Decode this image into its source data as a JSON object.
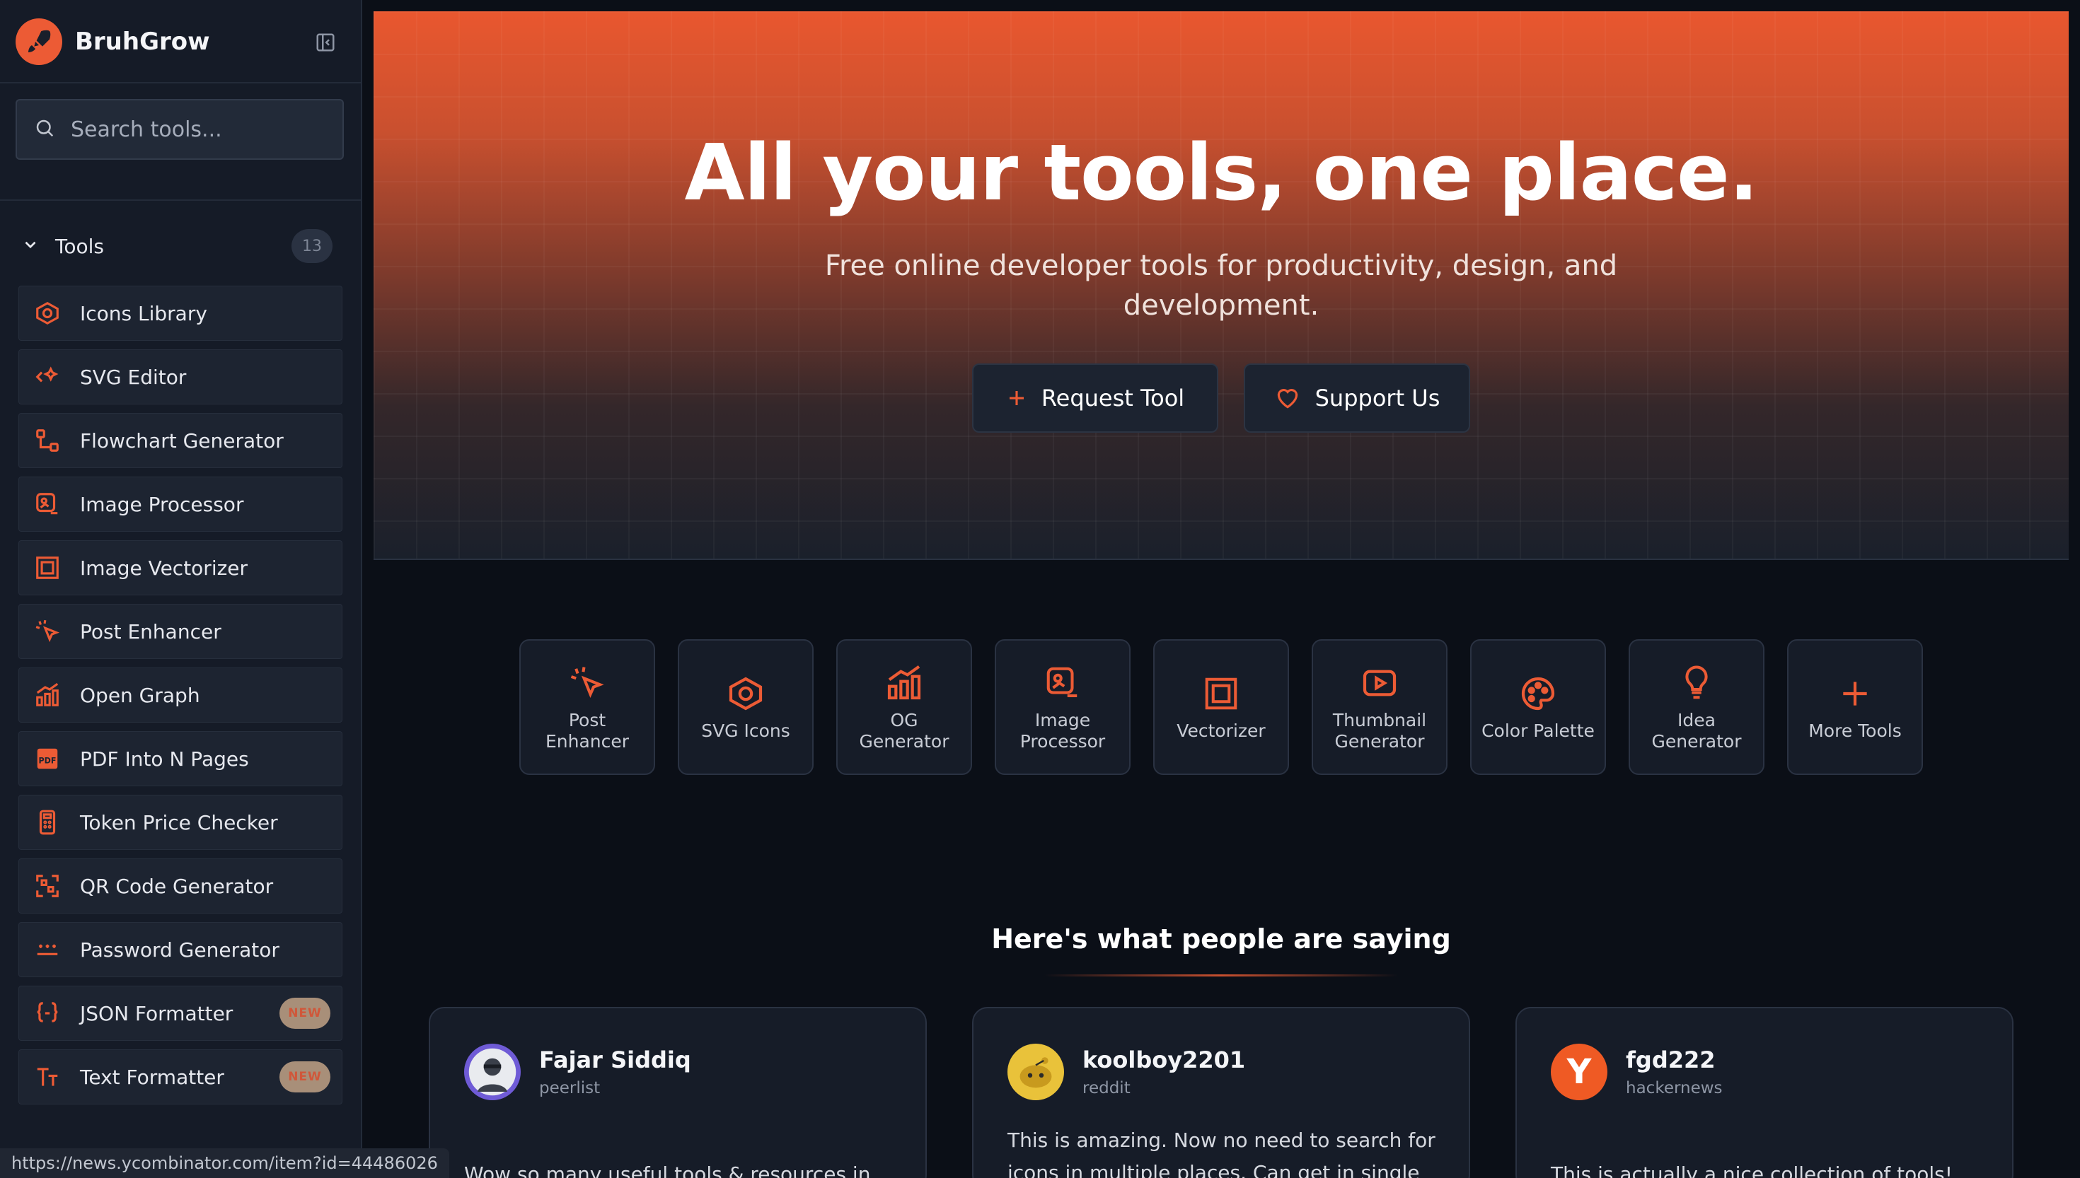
{
  "app": {
    "name": "BruhGrow"
  },
  "search": {
    "placeholder": "Search tools..."
  },
  "sidebar": {
    "section_title": "Tools",
    "section_count": "13",
    "items": [
      {
        "label": "Icons Library",
        "icon": "eye-icon"
      },
      {
        "label": "SVG Editor",
        "icon": "code-sparkle-icon"
      },
      {
        "label": "Flowchart Generator",
        "icon": "flowchart-icon"
      },
      {
        "label": "Image Processor",
        "icon": "image-edit-icon"
      },
      {
        "label": "Image Vectorizer",
        "icon": "vector-frame-icon"
      },
      {
        "label": "Post Enhancer",
        "icon": "cursor-click-icon"
      },
      {
        "label": "Open Graph",
        "icon": "bar-chart-icon"
      },
      {
        "label": "PDF Into N Pages",
        "icon": "pdf-icon"
      },
      {
        "label": "Token Price Checker",
        "icon": "calculator-icon"
      },
      {
        "label": "QR Code Generator",
        "icon": "qr-code-icon"
      },
      {
        "label": "Password Generator",
        "icon": "password-icon"
      },
      {
        "label": "JSON Formatter",
        "icon": "braces-icon",
        "badge": "NEW"
      },
      {
        "label": "Text Formatter",
        "icon": "text-type-icon",
        "badge": "NEW"
      }
    ]
  },
  "hero": {
    "title": "All your tools, one place.",
    "subtitle": "Free online developer tools for productivity, design, and development.",
    "request_label": "Request Tool",
    "support_label": "Support Us"
  },
  "quick_tools": [
    {
      "label": "Post Enhancer",
      "icon": "cursor-click-icon"
    },
    {
      "label": "SVG Icons",
      "icon": "eye-icon"
    },
    {
      "label": "OG Generator",
      "icon": "bar-chart-icon"
    },
    {
      "label": "Image Processor",
      "icon": "image-edit-icon"
    },
    {
      "label": "Vectorizer",
      "icon": "vector-frame-icon"
    },
    {
      "label": "Thumbnail Generator",
      "icon": "play-icon"
    },
    {
      "label": "Color Palette",
      "icon": "palette-icon"
    },
    {
      "label": "Idea Generator",
      "icon": "lightbulb-icon"
    },
    {
      "label": "More Tools",
      "icon": "plus-icon"
    }
  ],
  "testimonials": {
    "title": "Here's what people are saying",
    "items": [
      {
        "name": "Fajar Siddiq",
        "source": "peerlist",
        "quote": "Wow so many useful tools & resources in"
      },
      {
        "name": "koolboy2201",
        "source": "reddit",
        "quote": "This is amazing. Now no need to search for icons in multiple places. Can get in single"
      },
      {
        "name": "fgd222",
        "source": "hackernews",
        "avatar_letter": "Y",
        "quote": "This is actually a nice collection of tools!"
      }
    ]
  },
  "status_url": "https://news.ycombinator.com/item?id=44486026",
  "colors": {
    "accent": "#ec5b35",
    "background": "#0b0f17",
    "sidebar": "#151b27",
    "card": "#161c28"
  }
}
